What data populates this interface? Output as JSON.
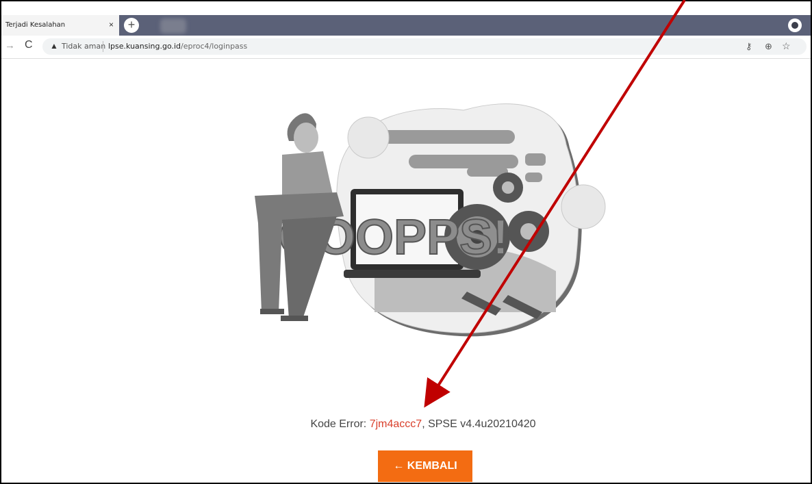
{
  "browser": {
    "tab_title": "Terjadi Kesalahan",
    "tab_close": "×",
    "new_tab": "+",
    "security_label": "Tidak aman",
    "url_host": "lpse.kuansing.go.id",
    "url_path": "/eproc4/loginpass"
  },
  "illustration": {
    "text": "OOOPPS!"
  },
  "error": {
    "prefix": "Kode Error: ",
    "code": "7jm4accc7",
    "suffix": ", SPSE v4.4u20210420"
  },
  "back_button": {
    "label": "← KEMBALI"
  },
  "colors": {
    "accent": "#f36c12",
    "error_code": "#d93f2b",
    "annotation_arrow": "#c00000"
  }
}
